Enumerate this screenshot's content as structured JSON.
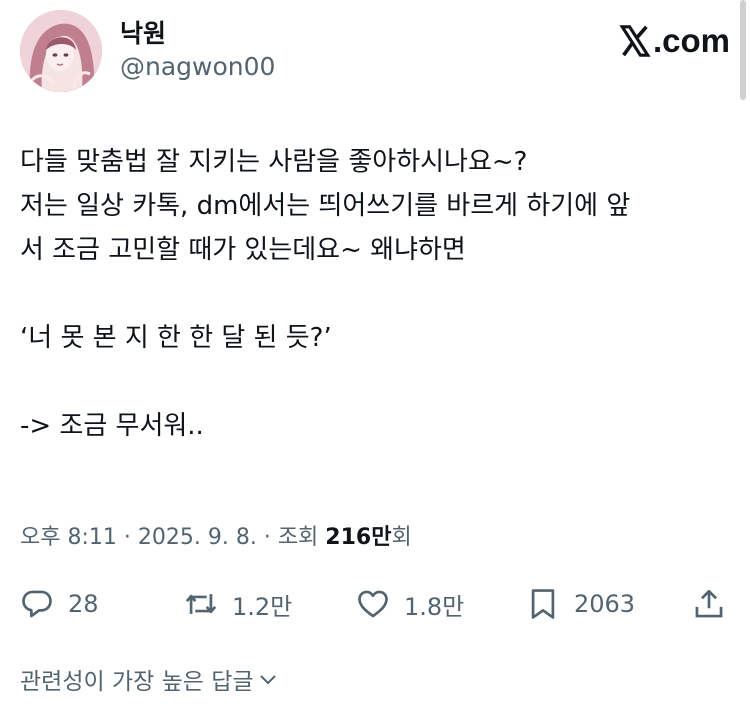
{
  "author": {
    "display_name": "낙원",
    "handle": "@nagwon00"
  },
  "brand": {
    "label": ".com"
  },
  "post": {
    "lines": [
      "다들 맞춤법 잘 지키는 사람을 좋아하시나요~?",
      "저는 일상 카톡, dm에서는 띄어쓰기를 바르게 하기에 앞",
      "서 조금 고민할 때가 있는데요~ 왜냐하면",
      "",
      "‘너 못 본 지 한 한 달 된 듯?’",
      "",
      "-> 조금 무서워.."
    ]
  },
  "meta": {
    "time": "오후 8:11",
    "sep1": " · ",
    "date": "2025. 9. 8.",
    "sep2": " · ",
    "views_label": "조회 ",
    "views_count": "216만",
    "views_suffix": "회"
  },
  "actions": {
    "replies": "28",
    "reposts": "1.2만",
    "likes": "1.8만",
    "bookmarks": "2063"
  },
  "replies_sort": {
    "label": "관련성이 가장 높은 답글"
  },
  "colors": {
    "text": "#0f1419",
    "secondary": "#536471"
  },
  "icons": [
    "reply-icon",
    "repost-icon",
    "like-icon",
    "bookmark-icon",
    "share-icon",
    "chevron-down-icon",
    "x-logo-icon"
  ]
}
